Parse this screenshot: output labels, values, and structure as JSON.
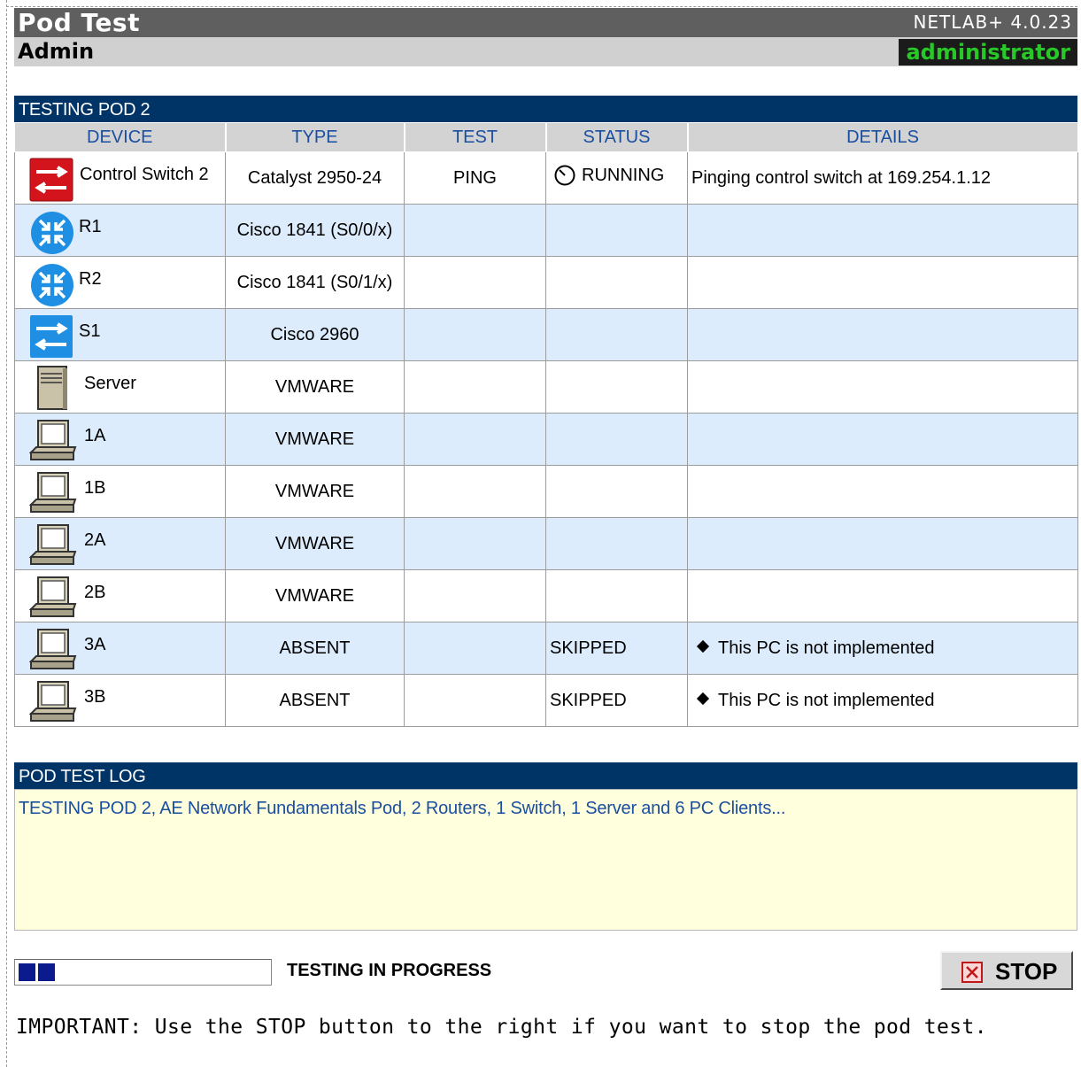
{
  "header": {
    "title": "Pod Test",
    "version": "NETLAB+ 4.0.23",
    "section": "Admin",
    "user": "administrator"
  },
  "testing_panel": {
    "title": "TESTING POD 2",
    "columns": [
      "DEVICE",
      "TYPE",
      "TEST",
      "STATUS",
      "DETAILS"
    ],
    "rows": [
      {
        "device": "Control Switch 2",
        "icon": "control-switch-icon",
        "type": "Catalyst 2950-24",
        "test": "PING",
        "status": "RUNNING",
        "details": "Pinging control switch at 169.254.1.12"
      },
      {
        "device": "R1",
        "icon": "router-icon",
        "type": "Cisco 1841 (S0/0/x)",
        "test": "",
        "status": "",
        "details": ""
      },
      {
        "device": "R2",
        "icon": "router-icon",
        "type": "Cisco 1841 (S0/1/x)",
        "test": "",
        "status": "",
        "details": ""
      },
      {
        "device": "S1",
        "icon": "switch-icon",
        "type": "Cisco 2960",
        "test": "",
        "status": "",
        "details": ""
      },
      {
        "device": "Server",
        "icon": "server-icon",
        "type": "VMWARE",
        "test": "",
        "status": "",
        "details": ""
      },
      {
        "device": "1A",
        "icon": "pc-icon",
        "type": "VMWARE",
        "test": "",
        "status": "",
        "details": ""
      },
      {
        "device": "1B",
        "icon": "pc-icon",
        "type": "VMWARE",
        "test": "",
        "status": "",
        "details": ""
      },
      {
        "device": "2A",
        "icon": "pc-icon",
        "type": "VMWARE",
        "test": "",
        "status": "",
        "details": ""
      },
      {
        "device": "2B",
        "icon": "pc-icon",
        "type": "VMWARE",
        "test": "",
        "status": "",
        "details": ""
      },
      {
        "device": "3A",
        "icon": "pc-icon",
        "type": "ABSENT",
        "test": "",
        "status": "SKIPPED",
        "details": "This PC is not implemented"
      },
      {
        "device": "3B",
        "icon": "pc-icon",
        "type": "ABSENT",
        "test": "",
        "status": "SKIPPED",
        "details": "This PC is not implemented"
      }
    ]
  },
  "log_panel": {
    "title": "POD TEST LOG",
    "lines": [
      "TESTING POD 2, AE Network Fundamentals Pod, 2 Routers, 1 Switch, 1 Server and 6 PC Clients..."
    ]
  },
  "progress": {
    "label": "TESTING IN PROGRESS",
    "filled_blocks": 2
  },
  "stop_button": {
    "label": "STOP",
    "icon": "close-x-icon"
  },
  "important_note": "IMPORTANT: Use the STOP button to the right if you want to stop the pod test.",
  "colors": {
    "header_bg": "#5f5f5f",
    "panel_header": "#003366",
    "row_alt": "#dcecfc",
    "log_bg": "#ffffdd",
    "user_text": "#27c827",
    "link_text": "#1a4fa0"
  }
}
